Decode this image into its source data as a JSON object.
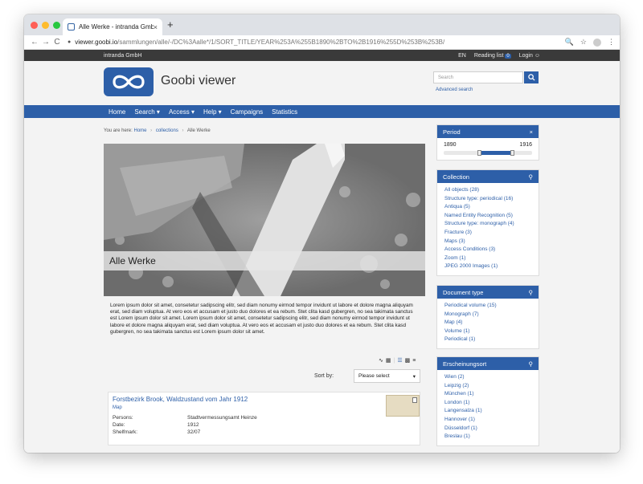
{
  "browser": {
    "tab_title": "Alle Werke - intranda GmbH",
    "tab_close": "×",
    "new_tab": "+",
    "url_host": "viewer.goobi.io",
    "url_path": "/sammlungen/alle/-/DC%3Aalle*/1/SORT_TITLE/YEAR%253A%255B1890%2BTO%2B1916%255D%253B%253B/",
    "nav": {
      "back": "←",
      "forward": "→",
      "reload": "C"
    },
    "icons": {
      "zoom": "🔍",
      "star": "☆",
      "menu": "⋮"
    }
  },
  "topbar": {
    "brand": "intranda GmbH",
    "language": "EN",
    "reading_list": "Reading list",
    "reading_list_count": "0",
    "login": "Login"
  },
  "header": {
    "title": "Goobi viewer",
    "search_placeholder": "Search",
    "advanced_search": "Advanced search"
  },
  "mainnav": {
    "items": [
      "Home",
      "Search ▾",
      "Access ▾",
      "Help ▾",
      "Campaigns",
      "Statistics"
    ]
  },
  "breadcrumb": {
    "prefix": "You are here:",
    "items": [
      "Home",
      "collections",
      "Alle Werke"
    ],
    "separator": "›"
  },
  "hero": {
    "title": "Alle Werke"
  },
  "description": "Lorem ipsum dolor sit amet, consetetur sadipscing elitr, sed diam nonumy eirmod tempor invidunt ut labore et dolore magna aliquyam erat, sed diam voluptua. At vero eos et accusam et justo duo dolores et ea rebum. Stet clita kasd gubergren, no sea takimata sanctus est Lorem ipsum dolor sit amet. Lorem ipsum dolor sit amet, consetetur sadipscing elitr, sed diam nonumy eirmod tempor invidunt ut labore et dolore magna aliquyam erat, sed diam voluptua. At vero eos et accusam et justo duo dolores et ea rebum. Stet clita kasd gubergren, no sea takimata sanctus est Lorem ipsum dolor sit amet.",
  "sort": {
    "label": "Sort by:",
    "selected": "Please select"
  },
  "result": {
    "title": "Forstbezirk Brook, Waldzustand vom Jahr 1912",
    "type": "Map",
    "fields": [
      {
        "key": "Persons:",
        "value": "Stadtvermessungsamt Heinze"
      },
      {
        "key": "Date:",
        "value": "1912"
      },
      {
        "key": "Shelfmark:",
        "value": "32/07"
      }
    ]
  },
  "sidebar": {
    "period": {
      "title": "Period",
      "close": "×",
      "from": "1890",
      "to": "1916",
      "start_fraction": 0.4,
      "end_fraction": 0.78
    },
    "collection": {
      "title": "Collection",
      "items": [
        "All objects (28)",
        "Structure type: periodical (16)",
        "Antiqua (5)",
        "Named Entity Recognition (5)",
        "Structure type: monograph (4)",
        "Fracture (3)",
        "Maps (3)",
        "Access Conditions (3)",
        "Zoom (1)",
        "JPEG 2000 Images (1)"
      ]
    },
    "doctype": {
      "title": "Document type",
      "items": [
        "Periodical volume (15)",
        "Monograph (7)",
        "Map (4)",
        "Volume (1)",
        "Periodical (1)"
      ]
    },
    "place": {
      "title": "Erscheinungsort",
      "items": [
        "Wien (2)",
        "Leipzig (2)",
        "München (1)",
        "London (1)",
        "Langensalza (1)",
        "Hannover (1)",
        "Düsseldorf (1)",
        "Breslau (1)"
      ]
    }
  },
  "colors": {
    "accent": "#2d5fa8",
    "topbar": "#3a3a3a",
    "background": "#f3f3f3"
  }
}
